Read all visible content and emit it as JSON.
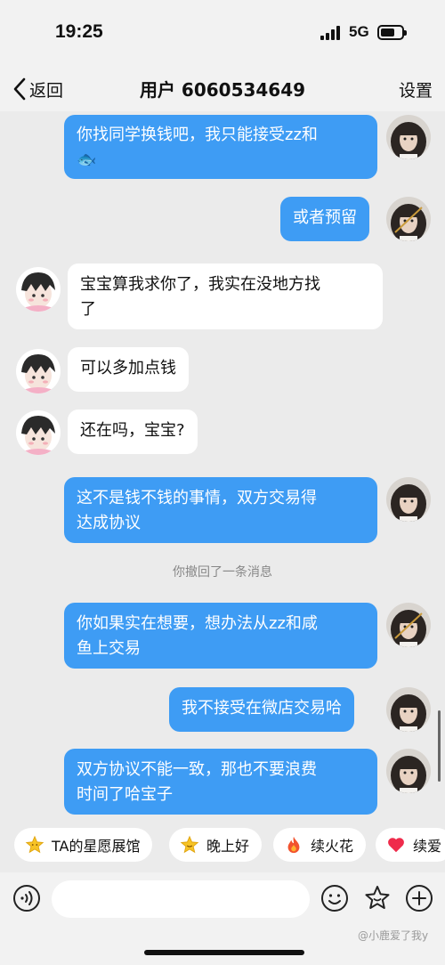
{
  "status_bar": {
    "time": "19:25",
    "network": "5G"
  },
  "nav": {
    "back_label": "返回",
    "title": "用户 6060534649",
    "settings_label": "设置"
  },
  "messages": [
    {
      "side": "right",
      "text": "你找同学换钱吧，我只能接受zz和\n🐟"
    },
    {
      "side": "right",
      "text": "或者预留"
    },
    {
      "side": "left",
      "text": "宝宝算我求你了，我实在没地方找\n了"
    },
    {
      "side": "left",
      "text": "可以多加点钱"
    },
    {
      "side": "left",
      "text": "还在吗，宝宝?"
    },
    {
      "side": "right",
      "text": "这不是钱不钱的事情，双方交易得\n达成协议"
    },
    {
      "side": "right",
      "text": "你如果实在想要，想办法从zz和咸\n鱼上交易"
    },
    {
      "side": "right",
      "text": "我不接受在微店交易哈"
    },
    {
      "side": "right",
      "text": "双方协议不能一致，那也不要浪费\n时间了哈宝子"
    }
  ],
  "system_note": "你撤回了一条消息",
  "quick_actions": [
    {
      "label": "TA的星愿展馆",
      "icon": "star-icon"
    },
    {
      "label": "晚上好",
      "icon": "sparkle-star-icon"
    },
    {
      "label": "续火花",
      "icon": "fire-icon"
    },
    {
      "label": "续爱",
      "icon": "heart-icon"
    }
  ],
  "input": {
    "placeholder": "",
    "value": ""
  },
  "watermark": "@小鹿爱了我y",
  "colors": {
    "outgoing_bubble": "#3e9cf4",
    "incoming_bubble": "#ffffff",
    "chat_background": "#ebebeb"
  }
}
